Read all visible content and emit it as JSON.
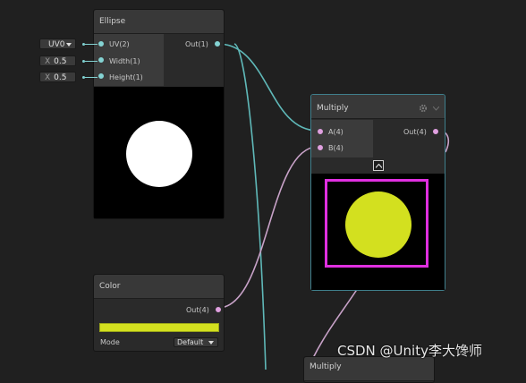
{
  "colors": {
    "wire_teal": "#5fb8b8",
    "wire_pink": "#c8a2c8",
    "swatch": "#d3e01f",
    "selection": "#e02fe0",
    "circle_white": "#ffffff",
    "circle_yellow": "#d3e01f"
  },
  "inputs": {
    "uv": {
      "value": "UV0",
      "icon": "dropdown-triangle-icon"
    },
    "width": {
      "axis": "X",
      "value": "0.5"
    },
    "height": {
      "axis": "X",
      "value": "0.5"
    }
  },
  "ellipse": {
    "title": "Ellipse",
    "in_uv": "UV(2)",
    "in_width": "Width(1)",
    "in_height": "Height(1)",
    "out": "Out(1)"
  },
  "multiply": {
    "title": "Multiply",
    "in_a": "A(4)",
    "in_b": "B(4)",
    "out": "Out(4)",
    "settings_icon": "gear-icon",
    "collapse_icon": "chevron-up-icon"
  },
  "color": {
    "title": "Color",
    "out": "Out(4)",
    "mode_label": "Mode",
    "mode_value": "Default"
  },
  "multiply2": {
    "title": "Multiply"
  },
  "watermark": "CSDN @Unity李大馋师"
}
